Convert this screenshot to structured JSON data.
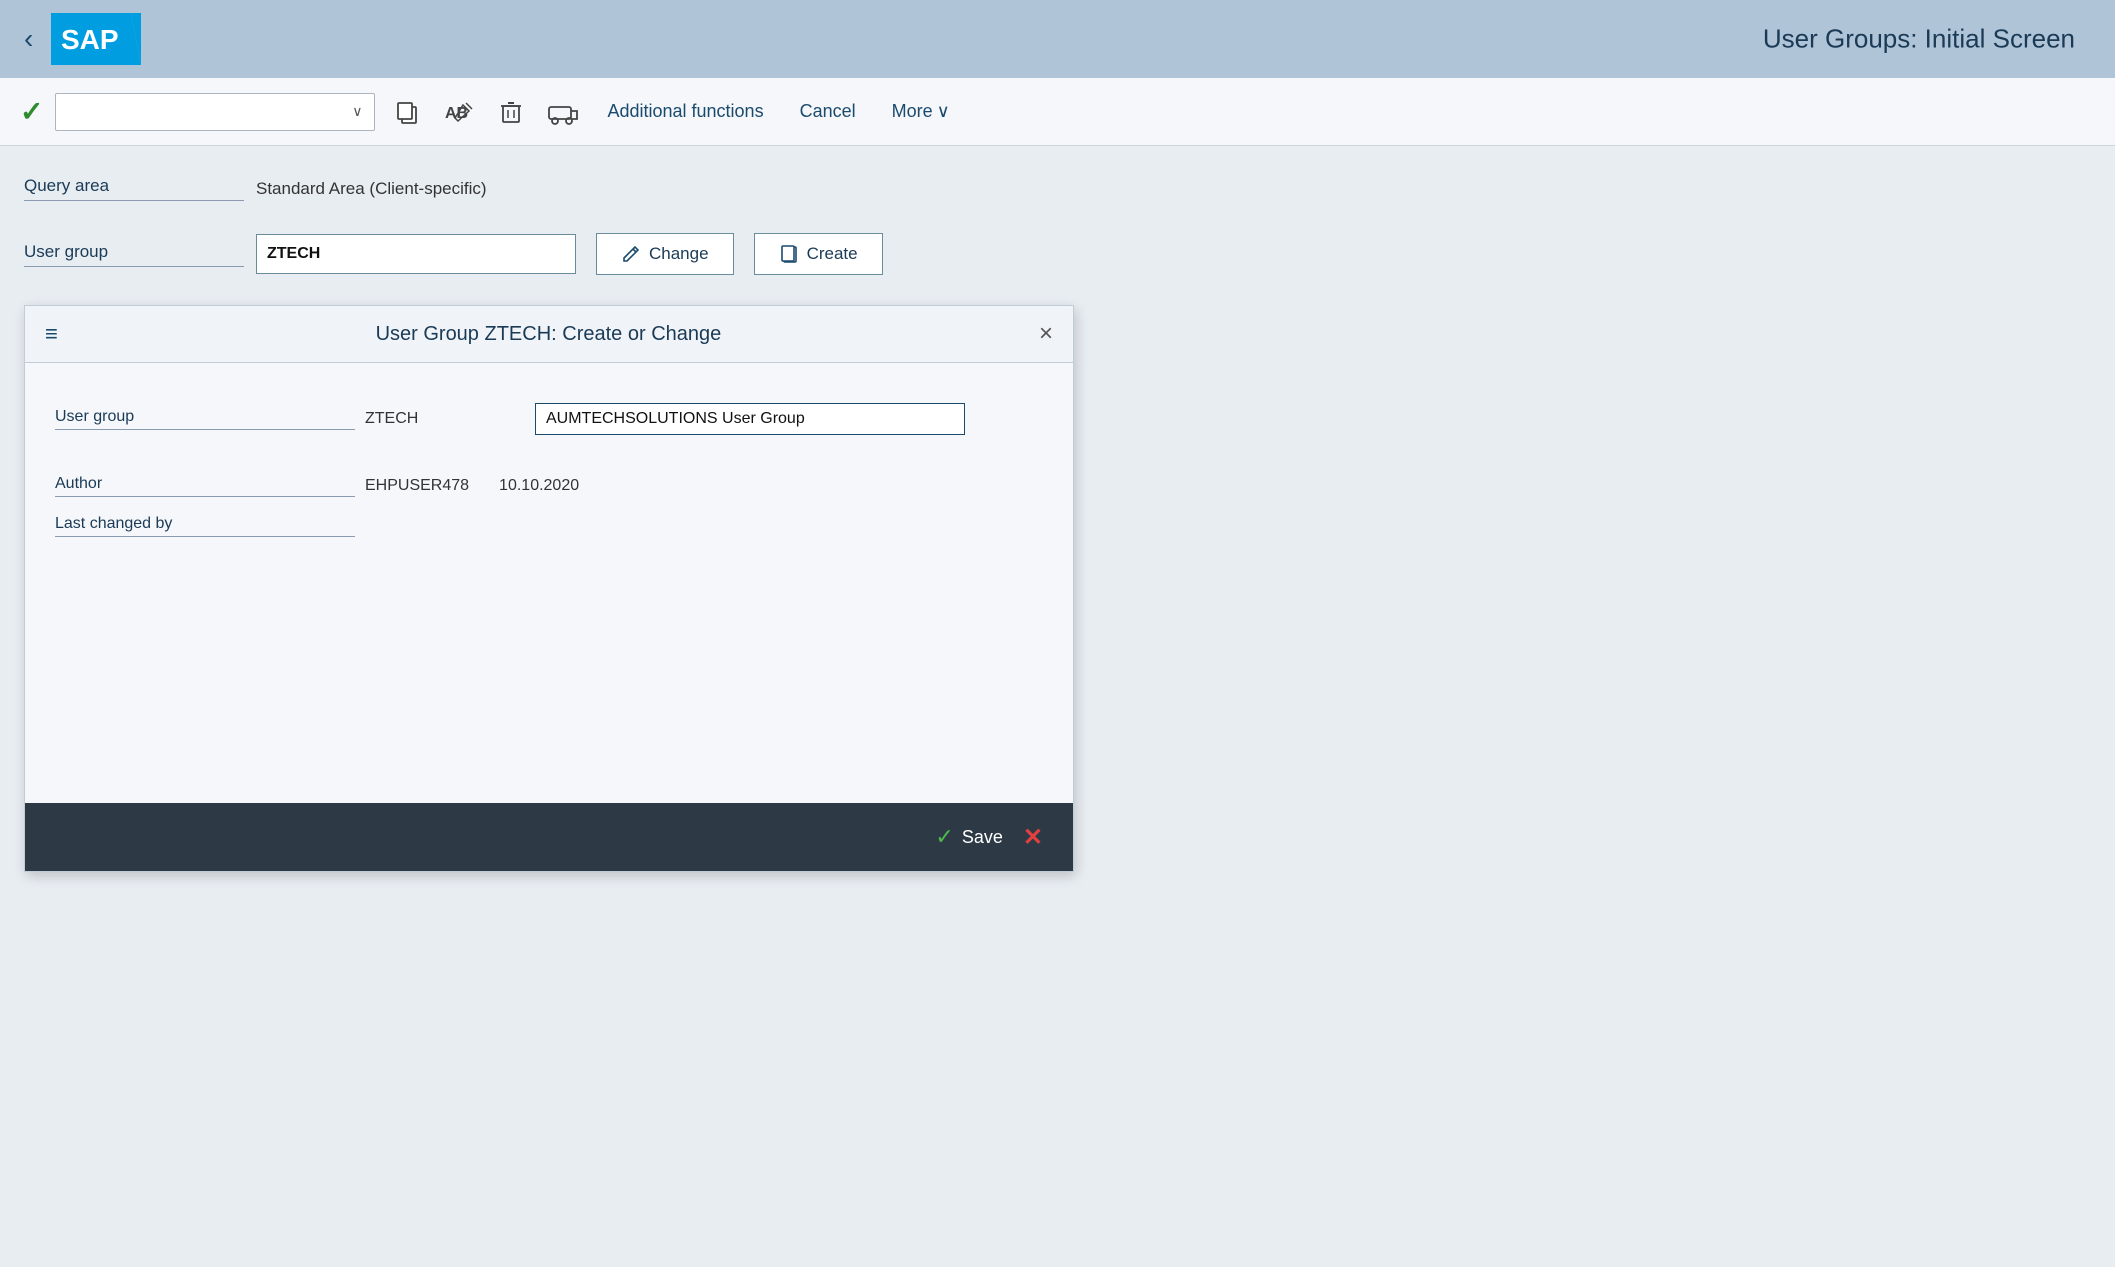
{
  "header": {
    "title": "User Groups: Initial Screen",
    "back_label": "‹"
  },
  "toolbar": {
    "confirm_icon": "✓",
    "dropdown_placeholder": "",
    "dropdown_arrow": "∨",
    "copy_icon": "⧉",
    "rename_icon": "AB",
    "delete_icon": "🗑",
    "transport_icon": "🚌",
    "additional_functions_label": "Additional functions",
    "cancel_label": "Cancel",
    "more_label": "More",
    "more_arrow": "∨"
  },
  "query_area": {
    "label": "Query area",
    "value": "Standard Area (Client-specific)"
  },
  "user_group": {
    "label": "User group",
    "input_value": "ZTECH",
    "change_btn": "Change",
    "create_btn": "Create",
    "change_icon": "✏",
    "create_icon": "📋"
  },
  "dialog": {
    "menu_icon": "≡",
    "title": "User Group ZTECH: Create or Change",
    "close_icon": "×",
    "fields": {
      "user_group_label": "User group",
      "user_group_static": "ZTECH",
      "user_group_input": "AUMTECHSOLUTIONS User Group",
      "author_label": "Author",
      "author_value": "EHPUSER478",
      "author_date": "10.10.2020",
      "last_changed_label": "Last changed by"
    },
    "footer": {
      "save_label": "Save",
      "save_check": "✓",
      "cancel_x": "✕"
    }
  }
}
